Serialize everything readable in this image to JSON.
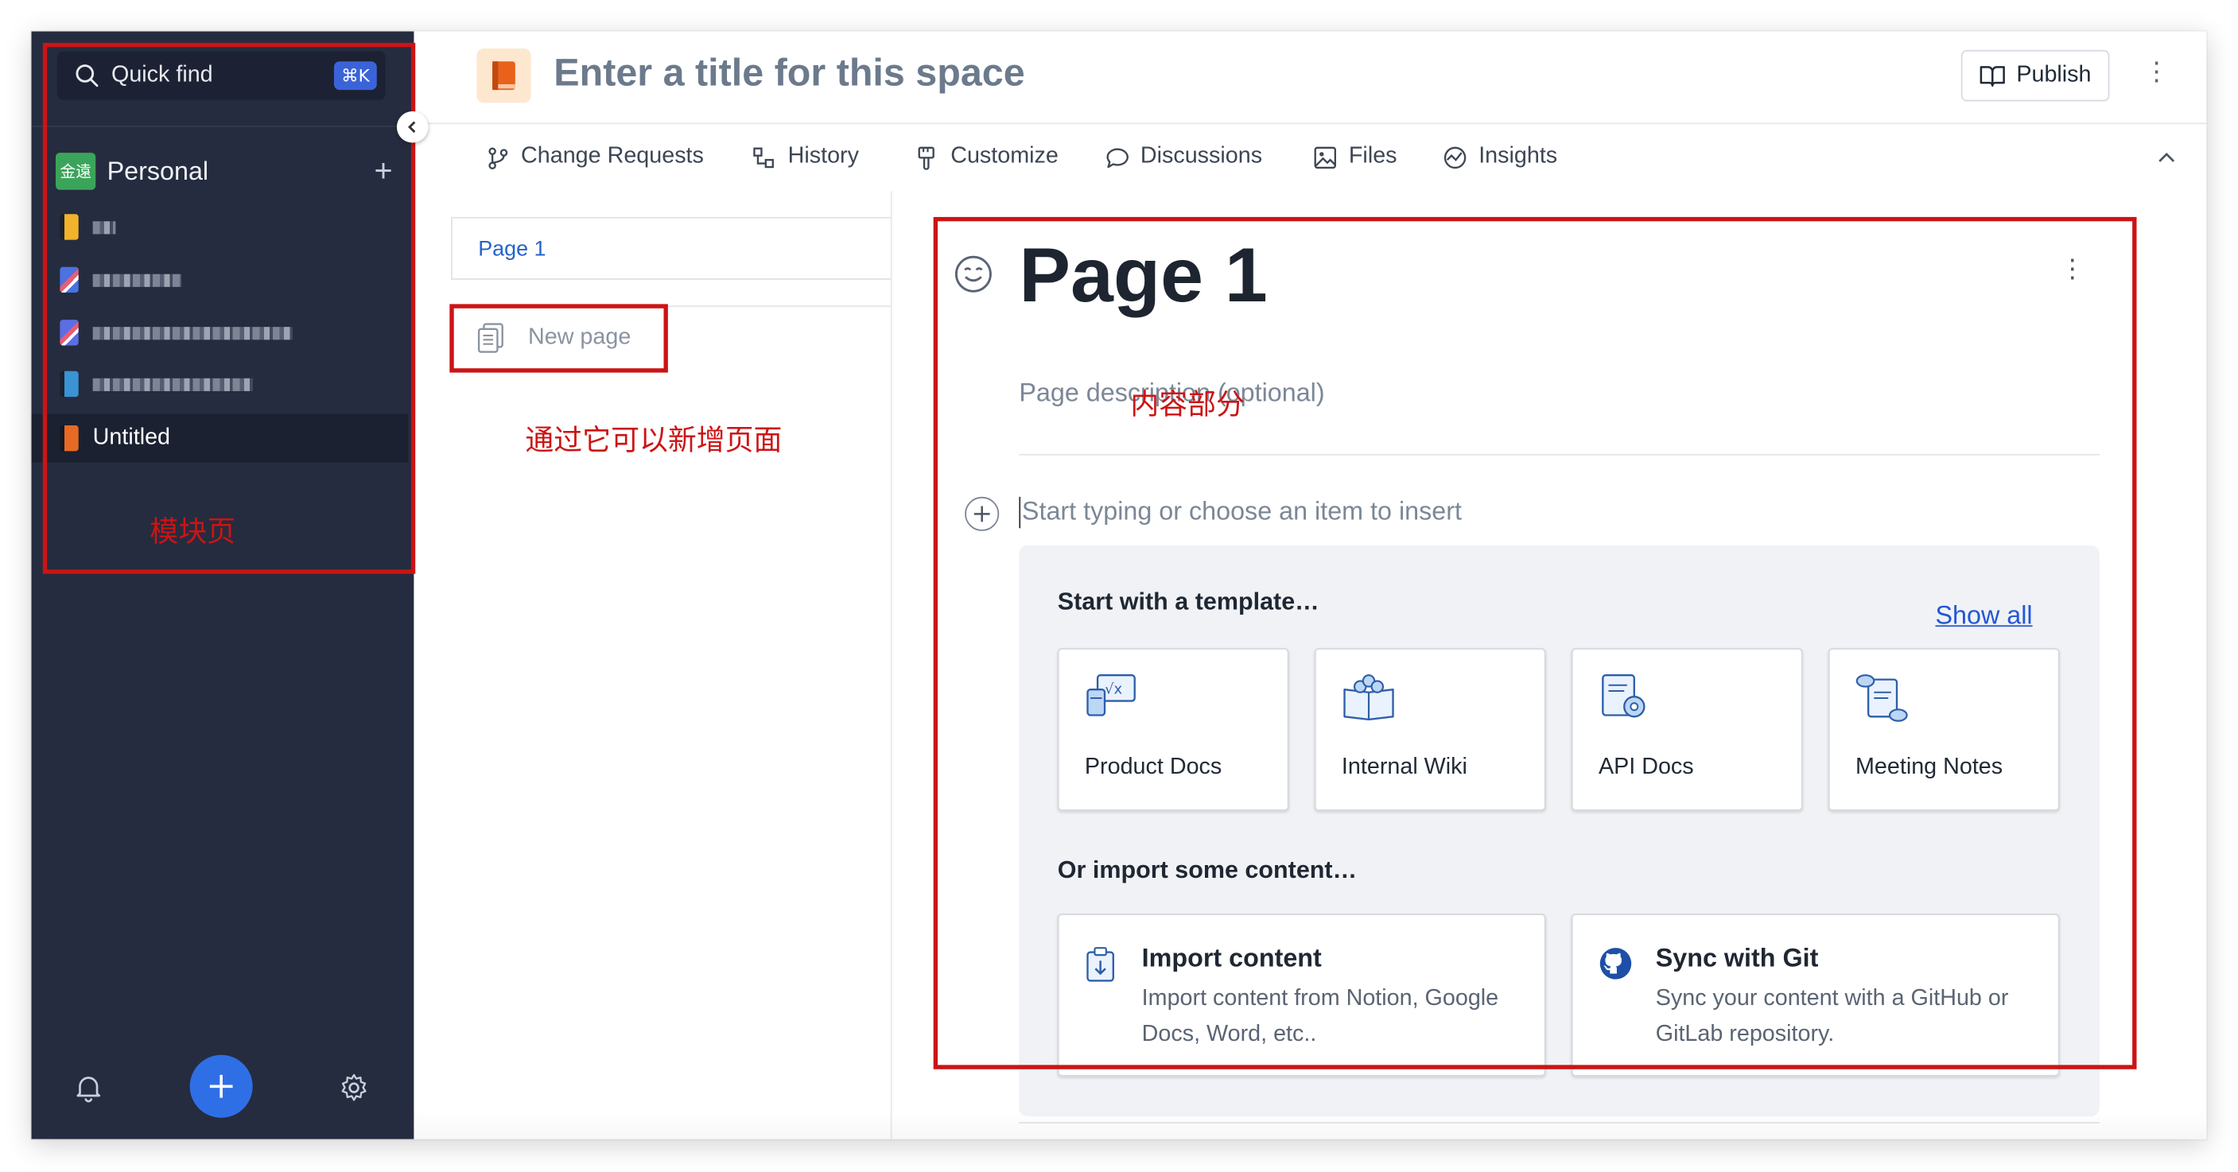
{
  "sidebar": {
    "search": {
      "label": "Quick find",
      "shortcut": "⌘K"
    },
    "space": {
      "logo_text": "金遠",
      "name": "Personal",
      "add_symbol": "+"
    },
    "items": [
      {
        "icon": "book-yellow-icon",
        "color": "#f2b22c",
        "label": "",
        "blurred": true
      },
      {
        "icon": "book-checker-icon",
        "color": "#4a72e0",
        "label": "",
        "blurred": true
      },
      {
        "icon": "book-checker-icon",
        "color": "#5b6ee3",
        "label": "",
        "blurred": true
      },
      {
        "icon": "book-blue-icon",
        "color": "#3a93d4",
        "label": "",
        "blurred": true
      },
      {
        "icon": "book-orange-icon",
        "color": "#e66a23",
        "label": "Untitled",
        "blurred": false,
        "active": true
      }
    ],
    "annotation": "模块页"
  },
  "header": {
    "title": "Enter a title for this space",
    "publish_label": "Publish",
    "more_symbol": "⋮"
  },
  "tabs": [
    {
      "label": "Change Requests",
      "icon": "branch-icon"
    },
    {
      "label": "History",
      "icon": "history-icon"
    },
    {
      "label": "Customize",
      "icon": "brush-icon"
    },
    {
      "label": "Discussions",
      "icon": "chat-icon"
    },
    {
      "label": "Files",
      "icon": "image-icon"
    },
    {
      "label": "Insights",
      "icon": "insights-icon"
    }
  ],
  "tabs_collapse_symbol": "︿",
  "tree": {
    "pages": [
      {
        "label": "Page 1"
      }
    ],
    "new_page_label": "New page",
    "annotation": "通过它可以新增页面"
  },
  "main": {
    "page_title": "Page 1",
    "page_more_symbol": "⋮",
    "description_placeholder": "Page description (optional)",
    "annotation": "内容部分",
    "insert_placeholder": "Start typing or choose an item to insert",
    "templates_heading": "Start with a template…",
    "show_all_label": "Show all",
    "templates": [
      {
        "label": "Product Docs",
        "icon": "product-docs-icon"
      },
      {
        "label": "Internal Wiki",
        "icon": "internal-wiki-icon"
      },
      {
        "label": "API Docs",
        "icon": "api-docs-icon"
      },
      {
        "label": "Meeting Notes",
        "icon": "meeting-notes-icon"
      }
    ],
    "import_heading": "Or import some content…",
    "imports": [
      {
        "title": "Import content",
        "description": "Import content from Notion, Google Docs, Word, etc..",
        "icon": "import-icon"
      },
      {
        "title": "Sync with Git",
        "description": "Sync your content with a GitHub or GitLab repository.",
        "icon": "github-icon"
      }
    ]
  },
  "colors": {
    "sidebar_bg": "#252c3f",
    "accent": "#2f6fe6",
    "annotation_red": "#cc1414",
    "link": "#2456d6"
  }
}
